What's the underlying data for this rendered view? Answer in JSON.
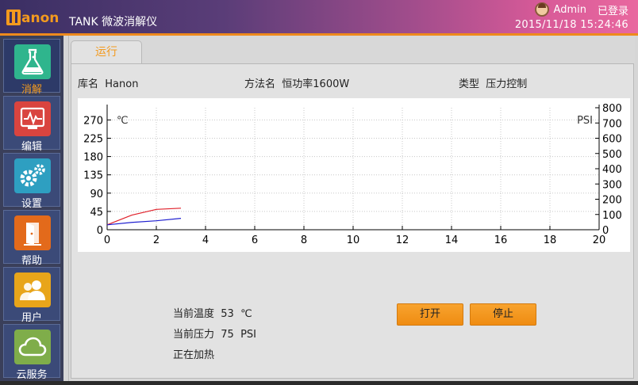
{
  "header": {
    "logo_text": "anon",
    "title": "TANK 微波消解仪",
    "user": "Admin",
    "login_status": "已登录",
    "datetime": "2015/11/18 15:24:46"
  },
  "sidebar": {
    "items": [
      {
        "label": "消解",
        "icon": "flask-icon",
        "color": "#2fb58d",
        "active": true
      },
      {
        "label": "编辑",
        "icon": "chart-edit-icon",
        "color": "#d9443f",
        "active": false
      },
      {
        "label": "设置",
        "icon": "gears-icon",
        "color": "#2e9fc1",
        "active": false
      },
      {
        "label": "帮助",
        "icon": "help-door-icon",
        "color": "#e36a1b",
        "active": false
      },
      {
        "label": "用户",
        "icon": "users-icon",
        "color": "#e8a51a",
        "active": false
      },
      {
        "label": "云服务",
        "icon": "cloud-icon",
        "color": "#7fad4a",
        "active": false
      }
    ]
  },
  "main": {
    "tab_label": "运行",
    "library_label": "库名",
    "library_value": "Hanon",
    "method_label": "方法名",
    "method_value": "恒功率1600W",
    "type_label": "类型",
    "type_value": "压力控制",
    "temp_label": "当前温度",
    "temp_value": "53",
    "temp_unit": "℃",
    "pressure_label": "当前压力",
    "pressure_value": "75",
    "pressure_unit": "PSI",
    "state_text": "正在加热",
    "open_button": "打开",
    "stop_button": "停止"
  },
  "chart_data": {
    "type": "line",
    "xlim": [
      0,
      20
    ],
    "x_ticks": [
      "0",
      "2",
      "4",
      "6",
      "8",
      "10",
      "12",
      "14",
      "16",
      "18",
      "20"
    ],
    "y_left_label": "℃",
    "y_left_lim": [
      0,
      300
    ],
    "y_left_ticks": [
      "0",
      "45",
      "90",
      "135",
      "180",
      "225",
      "270"
    ],
    "y_right_label": "PSI",
    "y_right_lim": [
      0,
      800
    ],
    "y_right_ticks": [
      "0",
      "100",
      "200",
      "300",
      "400",
      "500",
      "600",
      "700",
      "800"
    ],
    "grid": true,
    "series": [
      {
        "axis": "left",
        "color": "#e0202a",
        "x": [
          0,
          1,
          2,
          3
        ],
        "values": [
          12,
          36,
          50,
          53
        ]
      },
      {
        "axis": "left",
        "color": "#2020d0",
        "x": [
          0,
          1,
          2,
          3
        ],
        "values": [
          12,
          18,
          22,
          28
        ]
      }
    ],
    "colors": {
      "temperature": "#e0202a",
      "pressure": "#2020d0"
    }
  }
}
